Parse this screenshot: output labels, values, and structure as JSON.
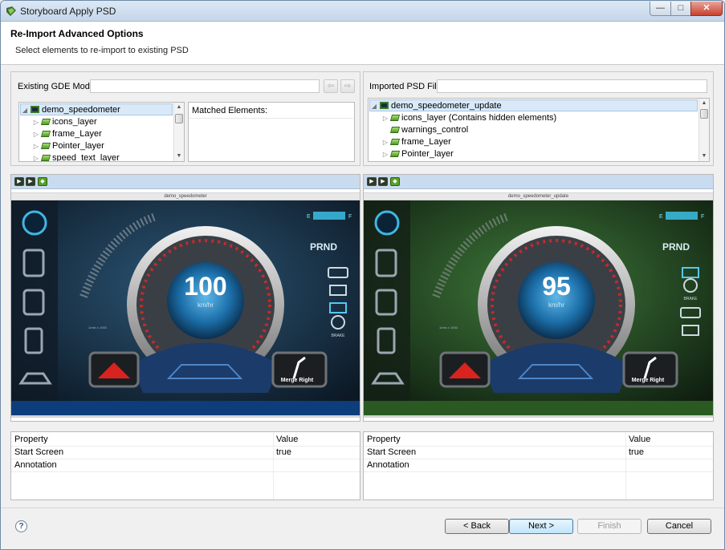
{
  "window": {
    "title": "Storyboard Apply PSD",
    "icon": "storyboard-app-icon",
    "controls": {
      "minimize": "—",
      "maximize": "□",
      "close": "✕"
    }
  },
  "header": {
    "title": "Re-Import Advanced Options",
    "subtitle": "Select elements to re-import to existing PSD"
  },
  "left": {
    "label": "Existing GDE Model",
    "nav": {
      "back": "⇦",
      "forward": "⇨"
    },
    "tree": {
      "root": "demo_speedometer",
      "items": [
        "icons_layer",
        "frame_Layer",
        "Pointer_layer",
        "speed_text_layer"
      ]
    },
    "matched_header": "Matched Elements:",
    "preview": {
      "screen_title": "demo_speedometer",
      "speed": "100",
      "unit": "km/hr",
      "merge_label": "Merge Right",
      "gear": "PRND",
      "gauge_min": "E",
      "gauge_max": "F",
      "rpm_caption": "1/min x 1000",
      "brake": "BRAKE"
    },
    "props": {
      "col_property": "Property",
      "col_value": "Value",
      "rows": [
        {
          "name": "Start Screen",
          "value": "true"
        },
        {
          "name": "Annotation",
          "value": ""
        }
      ]
    }
  },
  "right": {
    "label": "Imported PSD File",
    "tree": {
      "root": "demo_speedometer_update",
      "items": [
        "icons_layer  (Contains hidden elements)",
        "warnings_control",
        "frame_Layer",
        "Pointer_layer"
      ]
    },
    "preview": {
      "screen_title": "demo_speedometer_update",
      "speed": "95",
      "unit": "km/hr",
      "merge_label": "Merge Right",
      "gear": "PRND",
      "gauge_min": "E",
      "gauge_max": "F",
      "rpm_caption": "1/min x 1000",
      "brake": "BRAKE"
    },
    "props": {
      "col_property": "Property",
      "col_value": "Value",
      "rows": [
        {
          "name": "Start Screen",
          "value": "true"
        },
        {
          "name": "Annotation",
          "value": ""
        }
      ]
    }
  },
  "buttons": {
    "help": "?",
    "back": "< Back",
    "next": "Next >",
    "finish": "Finish",
    "cancel": "Cancel"
  },
  "colors": {
    "accent": "#3c7fb1",
    "selection": "#d9e9f8",
    "left_bg": "#1d3246",
    "right_bg": "#2d4a22"
  }
}
